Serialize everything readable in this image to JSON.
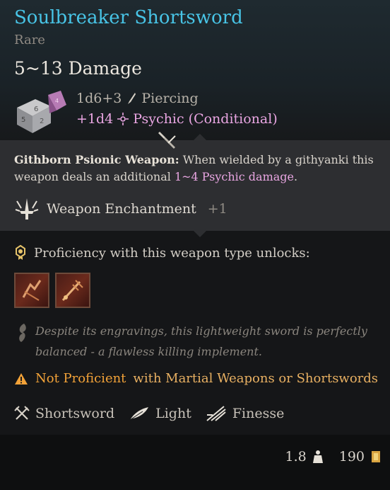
{
  "item": {
    "name": "Soulbreaker Shortsword",
    "rarity": "Rare",
    "damage_total": "5~13 Damage",
    "damage_lines": [
      {
        "dice": "1d6+3",
        "type": "Piercing",
        "icon": "piercing-icon"
      },
      {
        "dice": "+1d4",
        "type": "Psychic (Conditional)",
        "icon": "psychic-icon"
      }
    ]
  },
  "psionic": {
    "heading": "Githborn Psionic Weapon:",
    "text_before": " When wielded by a githyanki this weapon deals an additional ",
    "highlight": "1~4 Psychic damage",
    "text_after": "."
  },
  "enchantment": {
    "label": "Weapon Enchantment",
    "value": "+1",
    "icon": "sword-enchantment-icon"
  },
  "proficiency": {
    "label": "Proficiency with this weapon type unlocks:",
    "icon": "proficiency-gem-icon",
    "unlocks": [
      {
        "icon": "lacerate-action-icon"
      },
      {
        "icon": "pommel-strike-action-icon"
      }
    ]
  },
  "flavor": {
    "text": "Despite its engravings, this lightweight sword is perfectly balanced - a flawless killing implement.",
    "icon": "quill-icon"
  },
  "warning": {
    "part1": "Not Proficient",
    "part2": "with Martial Weapons or Shortswords",
    "icon": "warning-icon"
  },
  "properties": [
    {
      "label": "Shortsword",
      "icon": "crossed-swords-icon"
    },
    {
      "label": "Light",
      "icon": "feather-icon"
    },
    {
      "label": "Finesse",
      "icon": "finesse-icon"
    }
  ],
  "footer": {
    "weight": "1.8",
    "weight_icon": "weight-icon",
    "value": "190",
    "value_icon": "gold-coin-icon"
  },
  "colors": {
    "title": "#48c4e6",
    "psychic": "#e9a6e2",
    "warning": "#f2a238",
    "panel": "#2d2e31"
  }
}
